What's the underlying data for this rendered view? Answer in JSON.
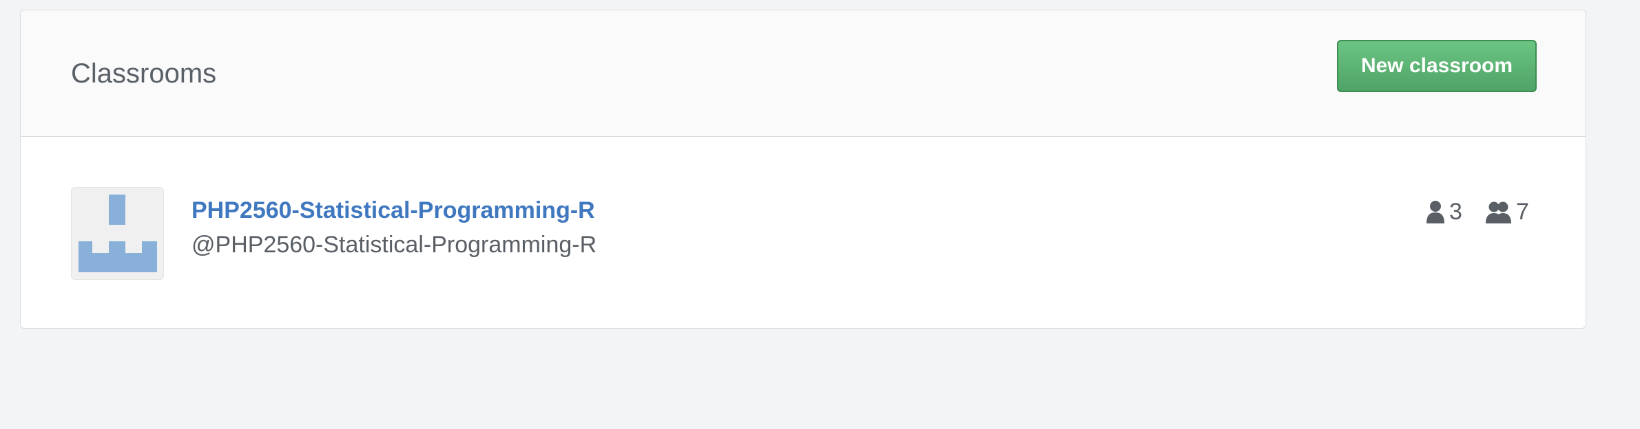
{
  "header": {
    "title": "Classrooms",
    "new_button_label": "New classroom"
  },
  "classrooms": [
    {
      "name": "PHP2560-Statistical-Programming-R",
      "handle": "@PHP2560-Statistical-Programming-R",
      "avatar_icon": "organization-avatar",
      "students": {
        "icon": "person-icon",
        "count": "3"
      },
      "teams": {
        "icon": "people-icon",
        "count": "7"
      }
    }
  ],
  "colors": {
    "page_background": "#f3f4f5",
    "link": "#4078c0",
    "button_green": "#5bb173",
    "avatar_blue": "#88b0d8",
    "text_muted": "#5a5f66"
  }
}
